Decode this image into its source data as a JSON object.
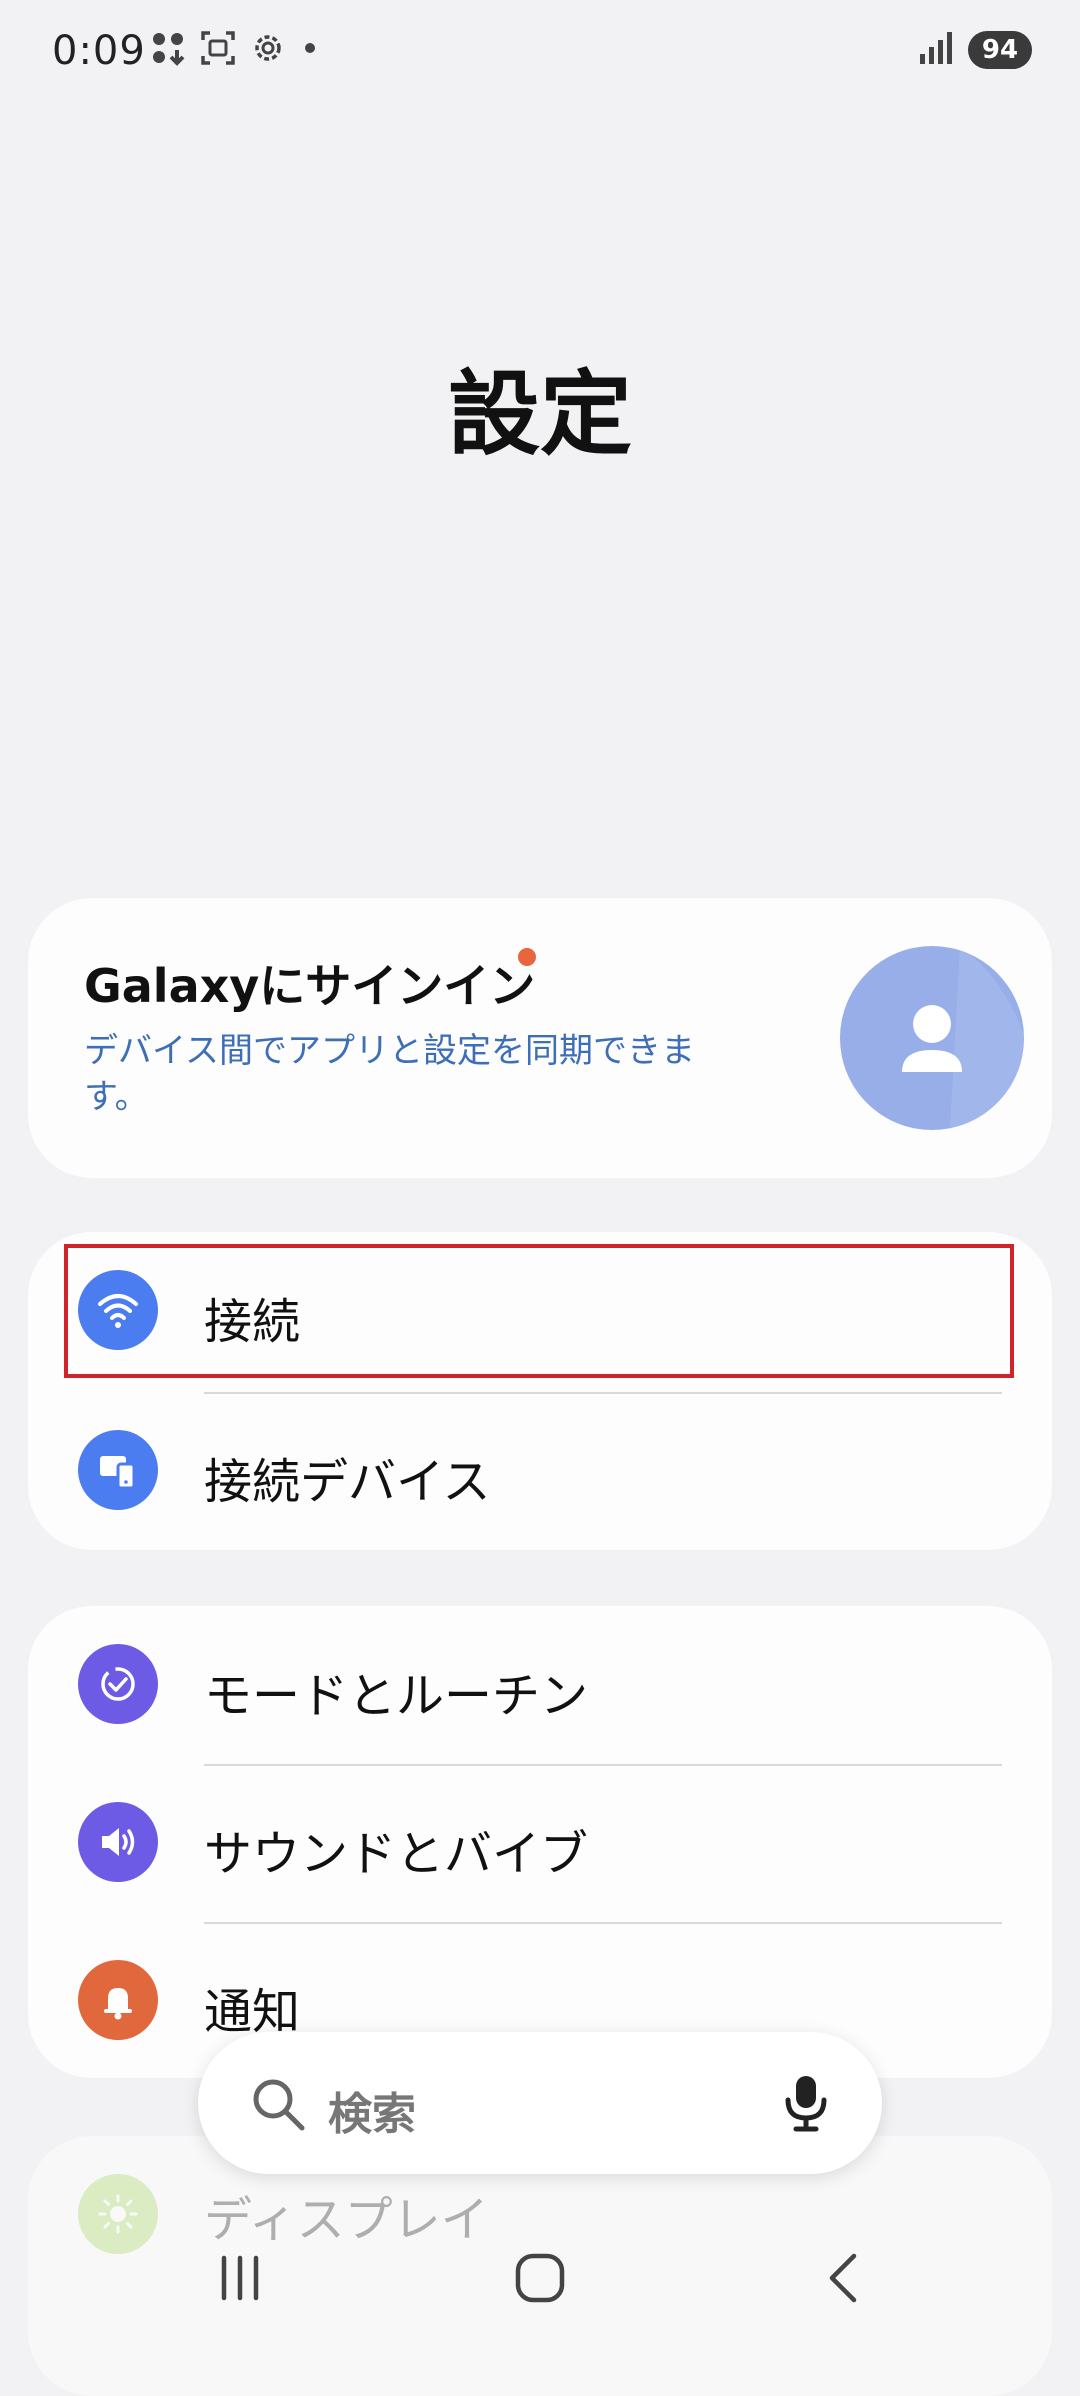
{
  "status_bar": {
    "time": "0:09",
    "battery": "94",
    "left_icons": [
      "apps-icon",
      "screenshot-icon",
      "gear-icon",
      "dot-icon"
    ],
    "right_icons": [
      "signal-icon"
    ]
  },
  "page": {
    "title": "設定"
  },
  "account": {
    "title": "Galaxyにサインイン",
    "description": "デバイス間でアプリと設定を同期できます。",
    "avatar_icon": "person-icon",
    "accent_color": "#e8663d"
  },
  "groups": [
    {
      "items": [
        {
          "label": "接続",
          "icon": "wifi-icon",
          "color": "#4b7df0"
        },
        {
          "label": "接続デバイス",
          "icon": "devices-icon",
          "color": "#4b7df0"
        }
      ]
    },
    {
      "items": [
        {
          "label": "モードとルーチン",
          "icon": "routine-icon",
          "color": "#6d5be6"
        },
        {
          "label": "サウンドとバイブ",
          "icon": "sound-icon",
          "color": "#6d5be6"
        },
        {
          "label": "通知",
          "icon": "bell-icon",
          "color": "#e1673c"
        }
      ]
    },
    {
      "items": [
        {
          "label": "ディスプレイ",
          "icon": "sun-icon",
          "color": "#a8d55d"
        }
      ]
    }
  ],
  "search": {
    "placeholder": "検索",
    "icons": [
      "search-icon",
      "mic-icon"
    ]
  },
  "nav": {
    "icons": [
      "recents-icon",
      "home-icon",
      "back-icon"
    ]
  },
  "highlight_color": "#d2232a"
}
